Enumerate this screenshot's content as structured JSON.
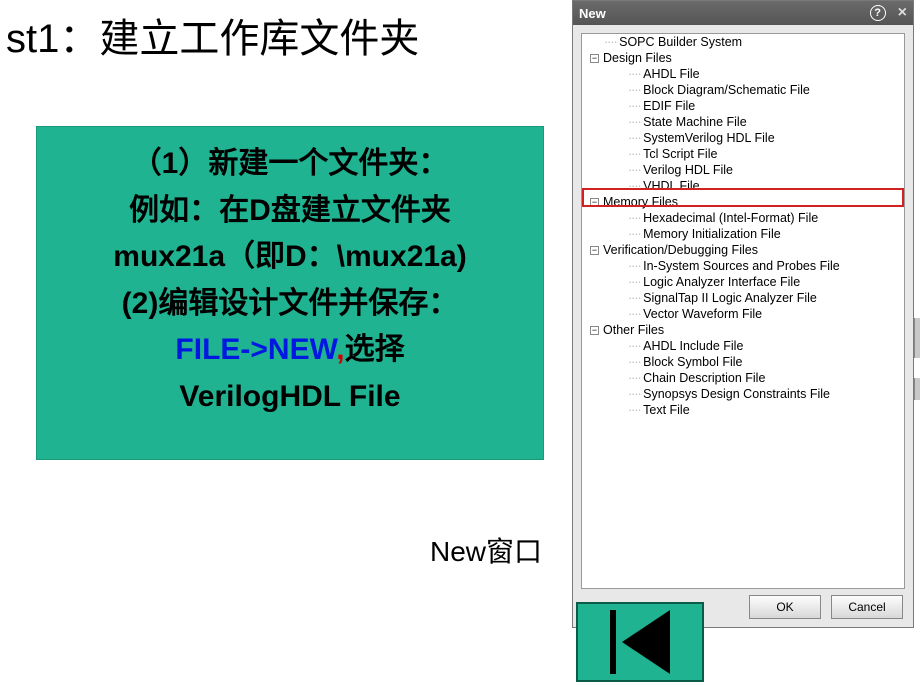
{
  "title": "st1：建立工作库文件夹",
  "green_box": {
    "line1": "（1）新建一个文件夹：",
    "line2": "例如：在D盘建立文件夹",
    "line3": "mux21a（即D：\\mux21a)",
    "line4": "(2)编辑设计文件并保存：",
    "line5_pre": "FILE->NEW",
    "line5_mid": ",",
    "line5_post": "选择",
    "line6": "VerilogHDL File"
  },
  "caption": "New窗口",
  "dialog": {
    "title": "New",
    "ok": "OK",
    "cancel": "Cancel"
  },
  "tree": {
    "root0": "SOPC Builder System",
    "cat_design": "Design Files",
    "design": [
      "AHDL File",
      "Block Diagram/Schematic File",
      "EDIF File",
      "State Machine File",
      "SystemVerilog HDL File",
      "Tcl Script File",
      "Verilog HDL File",
      "VHDL File"
    ],
    "cat_memory": "Memory Files",
    "memory": [
      "Hexadecimal (Intel-Format) File",
      "Memory Initialization File"
    ],
    "cat_verif": "Verification/Debugging Files",
    "verif": [
      "In-System Sources and Probes File",
      "Logic Analyzer Interface File",
      "SignalTap II Logic Analyzer File",
      "Vector Waveform File"
    ],
    "cat_other": "Other Files",
    "other": [
      "AHDL Include File",
      "Block Symbol File",
      "Chain Description File",
      "Synopsys Design Constraints File",
      "Text File"
    ]
  }
}
